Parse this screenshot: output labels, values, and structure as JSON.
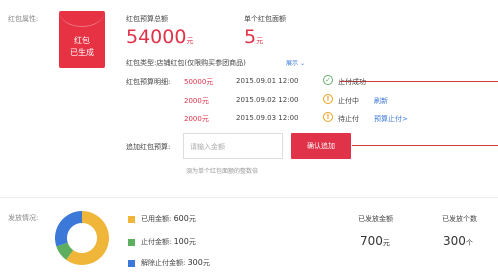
{
  "attributes": {
    "label": "红包属性:",
    "envelope_line1": "红包",
    "envelope_line2": "已生成"
  },
  "budget_total": {
    "label": "红包预算总额",
    "value": "54000",
    "unit": "元"
  },
  "single_face": {
    "label": "单个红包面额",
    "value": "5",
    "unit": "元"
  },
  "type": {
    "text": "红包类型:店铺红包(仅限购买参团商品)",
    "toggle_label": "展示",
    "toggle_icon": "chevron-down-icon"
  },
  "budget_detail": {
    "label": "红包预算明细:",
    "rows": [
      {
        "amount": "50000元",
        "datetime": "2015.09.01 12:00",
        "status_icon": "check-circle-icon",
        "status": "止付成功",
        "action": ""
      },
      {
        "amount": "2000元",
        "datetime": "2015.09.02 12:00",
        "status_icon": "exclamation-circle-icon",
        "status": "止付中",
        "action": "刷新"
      },
      {
        "amount": "2000元",
        "datetime": "2015.09.03 12:00",
        "status_icon": "exclamation-circle-icon",
        "status": "待止付",
        "action": "预算止付>"
      }
    ]
  },
  "add_budget": {
    "label": "追加红包预算:",
    "placeholder": "请输入金额",
    "hint": "須为单个红包面额的整数倍",
    "button": "确认追加"
  },
  "release": {
    "label": "发放情况:",
    "legend": [
      {
        "label": "已用金额:",
        "value": "600",
        "unit": "元",
        "color": "#f0b63a"
      },
      {
        "label": "止付金额:",
        "value": "100",
        "unit": "元",
        "color": "#5dae5f"
      },
      {
        "label": "解除止付金额:",
        "value": "300",
        "unit": "元",
        "color": "#3b78d8"
      }
    ],
    "issued_total": {
      "label": "已发放金额",
      "value": "700",
      "unit": "元"
    },
    "issued_count": {
      "label": "已发放个数",
      "value": "300",
      "unit": "个"
    },
    "donut": {
      "used": 600,
      "stopped": 100,
      "released": 300
    }
  },
  "colors": {
    "accent_red": "#e0334a",
    "green": "#5dae5f",
    "orange": "#f0b63a",
    "blue": "#3b78d8"
  }
}
